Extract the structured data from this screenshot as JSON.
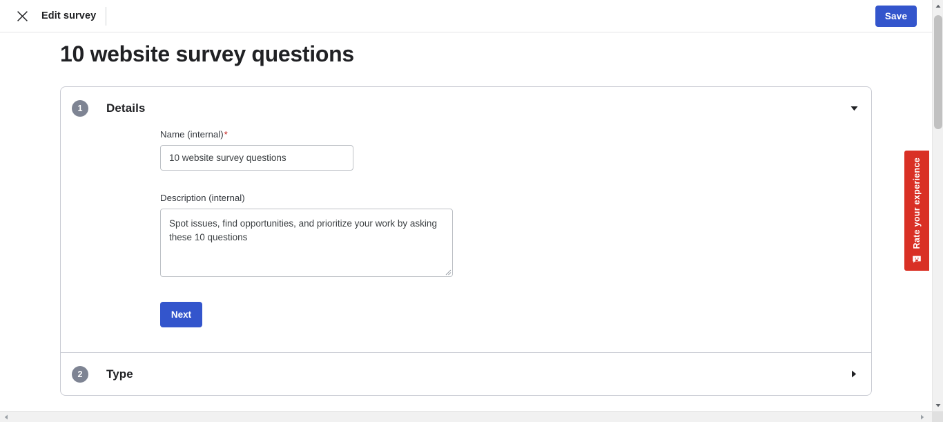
{
  "topbar": {
    "close_icon": "close-icon",
    "title": "Edit survey",
    "save_label": "Save"
  },
  "page": {
    "title": "10 website survey questions"
  },
  "card": {
    "sections": [
      {
        "number": "1",
        "title": "Details",
        "toggle_icon": "chevron-down-icon",
        "expanded": true,
        "fields": [
          {
            "label": "Name (internal)",
            "required_marker": "*",
            "type": "text",
            "value": "10 website survey questions",
            "placeholder": ""
          },
          {
            "label": "Description (internal)",
            "required_marker": "",
            "type": "textarea",
            "value": "Spot issues, find opportunities, and prioritize your work by asking these 10 questions",
            "placeholder": ""
          }
        ],
        "next_label": "Next"
      },
      {
        "number": "2",
        "title": "Type",
        "toggle_icon": "chevron-right-icon",
        "expanded": false
      }
    ]
  },
  "feedback": {
    "label": "Rate your experience",
    "icon": "feedback-smiley-icon",
    "color": "#d93025"
  },
  "colors": {
    "accent": "#3355cc",
    "step_circle": "#7e8493",
    "required": "#c5221f",
    "border": "#c9cbd3",
    "text": "#202124"
  },
  "scrollbars": {
    "vertical_up_icon": "triangle-up-icon",
    "vertical_down_icon": "triangle-down-icon",
    "horizontal_left_icon": "triangle-left-icon",
    "horizontal_right_icon": "triangle-right-icon"
  }
}
